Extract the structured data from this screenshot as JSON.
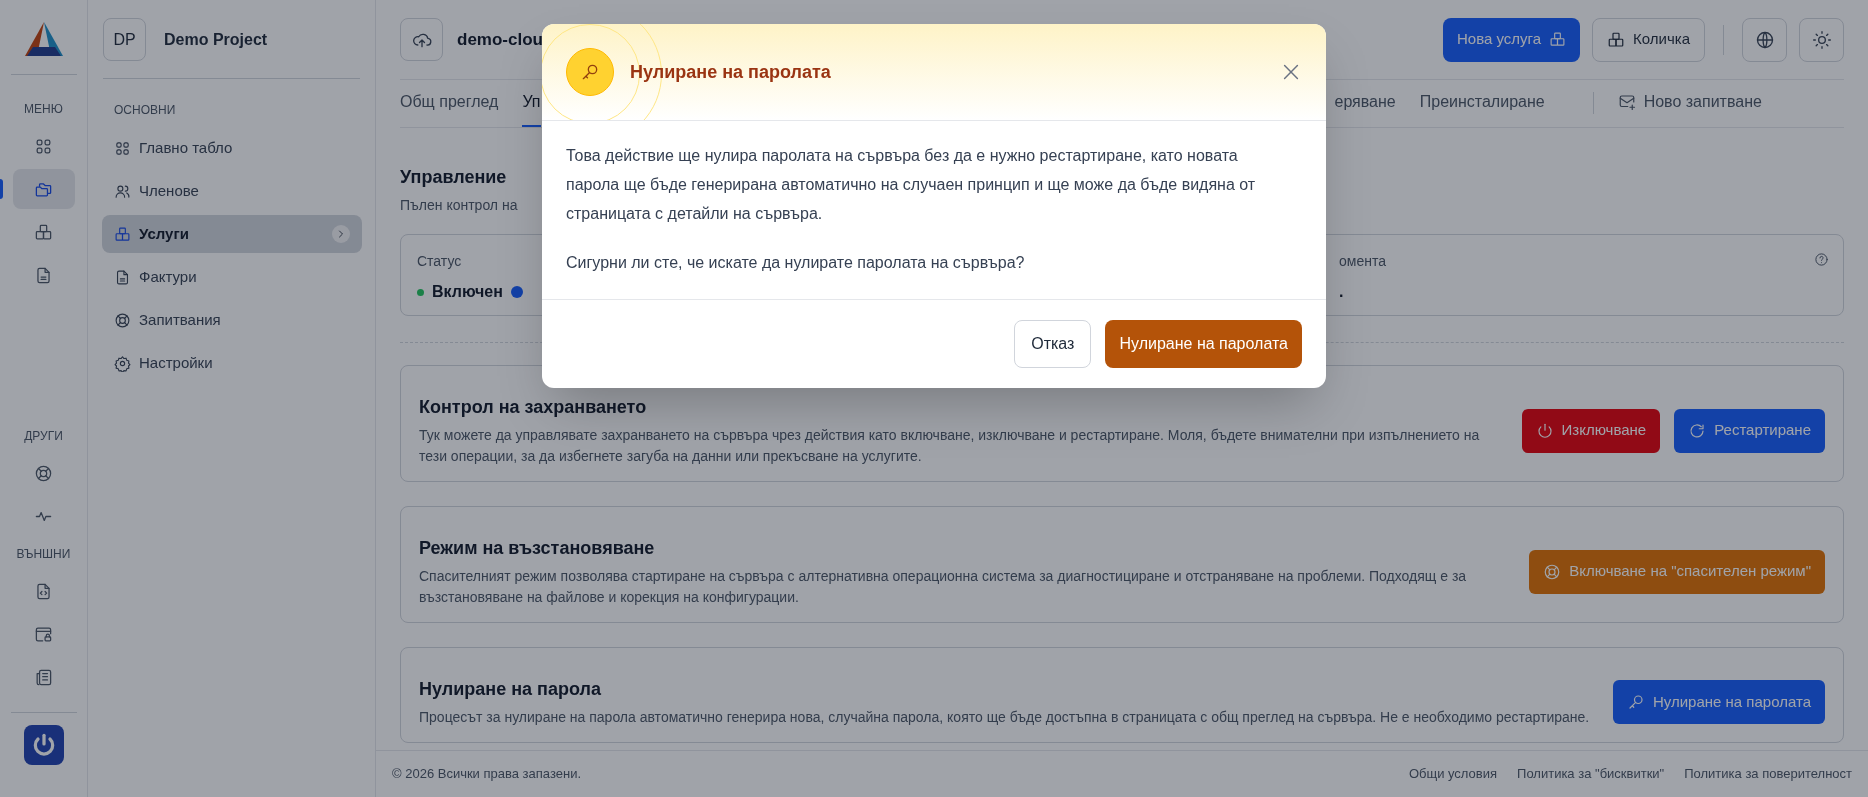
{
  "rail": {
    "groups": [
      {
        "label": "МЕНЮ",
        "items": [
          {
            "selected": false
          },
          {
            "selected": true
          },
          {
            "selected": false
          },
          {
            "selected": false
          }
        ]
      },
      {
        "label": "ДРУГИ",
        "items": [
          {
            "selected": false
          },
          {
            "selected": false
          }
        ]
      },
      {
        "label": "ВЪНШНИ",
        "items": [
          {
            "selected": false
          },
          {
            "selected": false
          },
          {
            "selected": false
          }
        ]
      }
    ]
  },
  "project": {
    "initials": "DP",
    "name": "Demo Project"
  },
  "sidebar": {
    "section": "ОСНОВНИ",
    "items": [
      {
        "label": "Главно табло",
        "selected": false
      },
      {
        "label": "Членове",
        "selected": false
      },
      {
        "label": "Услуги",
        "selected": true
      },
      {
        "label": "Фактури",
        "selected": false
      },
      {
        "label": "Запитвания",
        "selected": false
      },
      {
        "label": "Настройки",
        "selected": false
      }
    ]
  },
  "header": {
    "title": "demo-clou",
    "buttons": [
      {
        "label": "Нова услуга",
        "kind": "primary"
      },
      {
        "label": "Количка",
        "kind": "outline"
      }
    ]
  },
  "tabs": [
    {
      "label": "Общ преглед",
      "selected": false
    },
    {
      "label": "Уп",
      "selected": true
    },
    {
      "label": "еряване",
      "selected": false
    },
    {
      "label": "Преинсталиране",
      "selected": false
    },
    {
      "label": "Ново запитване",
      "selected": false
    }
  ],
  "management": {
    "title": "Управление",
    "subtitle": "Пълен контрол на"
  },
  "stats": [
    {
      "label": "Статус",
      "value": "Включен",
      "color": "#1b8048"
    },
    {
      "label": "омента",
      "value": "."
    }
  ],
  "action_cards": [
    {
      "title": "Контрол на захранването",
      "description": "Тук можете да управлявате захранването на сървъра чрез действия като включване, изключване и рестартиране. Моля, бъдете внимателни при изпълнението на тези операции, за да избегнете загуба на данни или прекъсване на услугите.",
      "buttons": [
        {
          "label": "Изключване",
          "kind": "danger"
        },
        {
          "label": "Рестартиране",
          "kind": "primary"
        }
      ]
    },
    {
      "title": "Режим на възстановяване",
      "description": "Спасителният режим позволява стартиране на сървъра с алтернативна операционна система за диагностициране и отстраняване на проблеми. Подходящ е за възстановяване на файлове и корекция на конфигурации.",
      "buttons": [
        {
          "label": "Включване на \"спасителен режим\"",
          "kind": "warning"
        }
      ]
    },
    {
      "title": "Нулиране на парола",
      "description": "Процесът за нулиране на парола автоматично генерира нова, случайна парола, която ще бъде достъпна в страницата с общ преглед на сървъра. Не е необходимо рестартиране.",
      "buttons": [
        {
          "label": "Нулиране на паролата",
          "kind": "primary"
        }
      ]
    }
  ],
  "footer": {
    "copyright": "© 2026 Всички права запазени.",
    "links": [
      "Общи условия",
      "Политика за \"бисквитки\"",
      "Политика за поверителност"
    ]
  },
  "modal": {
    "title": "Нулиране на паролата",
    "paragraphs": [
      "Това действие ще нулира паролата на сървъра без да е нужно рестартиране, като новата парола ще бъде генерирана автоматично на случаен принцип и ще може да бъде видяна от страницата с детайли на сървъра.",
      "Сигурни ли сте, че искате да нулирате паролата на сървъра?"
    ],
    "cancel": "Отказ",
    "confirm": "Нулиране на паролата"
  }
}
